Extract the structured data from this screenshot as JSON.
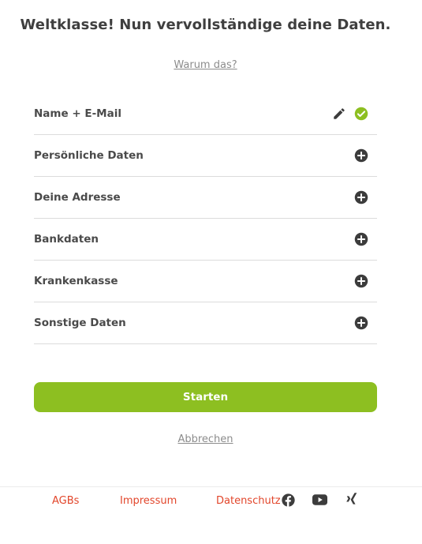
{
  "header": {
    "title": "Weltklasse! Nun vervollständige deine Daten.",
    "why_link": "Warum das?"
  },
  "sections": [
    {
      "label": "Name + E-Mail",
      "state": "completed",
      "icons": [
        "pencil-icon",
        "check-circle-icon"
      ]
    },
    {
      "label": "Persönliche Daten",
      "state": "open",
      "icons": [
        "plus-circle-icon"
      ]
    },
    {
      "label": "Deine Adresse",
      "state": "open",
      "icons": [
        "plus-circle-icon"
      ]
    },
    {
      "label": "Bankdaten",
      "state": "open",
      "icons": [
        "plus-circle-icon"
      ]
    },
    {
      "label": "Krankenkasse",
      "state": "open",
      "icons": [
        "plus-circle-icon"
      ]
    },
    {
      "label": "Sonstige Daten",
      "state": "open",
      "icons": [
        "plus-circle-icon"
      ]
    }
  ],
  "actions": {
    "start_label": "Starten",
    "cancel_label": "Abbrechen"
  },
  "footer": {
    "links": [
      "AGBs",
      "Impressum",
      "Datenschutz"
    ],
    "social_icons": [
      "facebook-icon",
      "youtube-icon",
      "xing-icon"
    ]
  },
  "colors": {
    "accent_green": "#8dbf21",
    "check_green": "#8dbf21",
    "footer_link": "#e2462b",
    "icon_dark": "#3c3c3c"
  }
}
